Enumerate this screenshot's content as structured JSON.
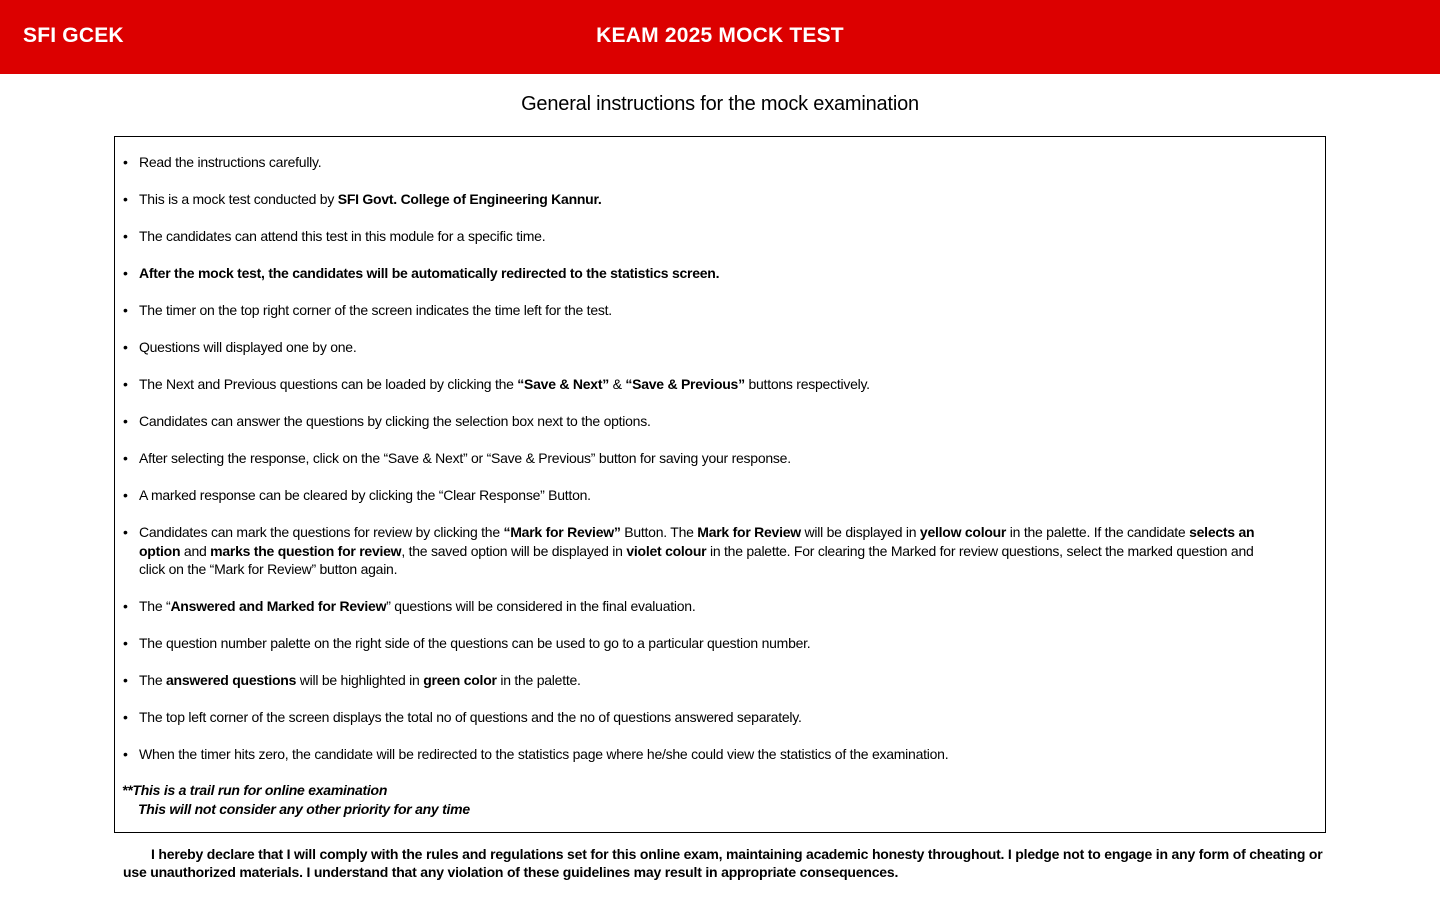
{
  "header": {
    "brand": "SFI GCEK",
    "title": "KEAM 2025 MOCK TEST",
    "bg_color": "#dc0000"
  },
  "heading": "General instructions for the mock examination",
  "instructions": [
    [
      {
        "t": "Read the instructions carefully."
      }
    ],
    [
      {
        "t": "This is a mock test conducted by "
      },
      {
        "t": "SFI Govt. College of Engineering Kannur.",
        "b": true
      }
    ],
    [
      {
        "t": "The candidates can attend this test in this module for a specific time."
      }
    ],
    [
      {
        "t": "After the mock test, the candidates will be automatically redirected to the statistics screen.",
        "b": true
      }
    ],
    [
      {
        "t": "The timer on the top right corner of the screen indicates the time left for the test."
      }
    ],
    [
      {
        "t": "Questions will displayed one by one."
      }
    ],
    [
      {
        "t": "The Next and Previous questions can be loaded by clicking the "
      },
      {
        "t": "“Save & Next”",
        "b": true
      },
      {
        "t": " & "
      },
      {
        "t": "“Save & Previous”",
        "b": true
      },
      {
        "t": " buttons respectively."
      }
    ],
    [
      {
        "t": "Candidates can answer the questions by clicking the selection box next to the options."
      }
    ],
    [
      {
        "t": "After selecting the response, click on the “Save & Next” or “Save & Previous” button for saving your response."
      }
    ],
    [
      {
        "t": "A marked response can be cleared by clicking the “Clear Response” Button."
      }
    ],
    [
      {
        "t": "Candidates can mark the questions for review by clicking the "
      },
      {
        "t": "“Mark for Review”",
        "b": true
      },
      {
        "t": " Button. The "
      },
      {
        "t": "Mark for Review",
        "b": true
      },
      {
        "t": " will be displayed in "
      },
      {
        "t": "yellow colour",
        "b": true
      },
      {
        "t": " in the palette. If the candidate "
      },
      {
        "t": "selects an option",
        "b": true
      },
      {
        "t": " and "
      },
      {
        "t": "marks the question for review",
        "b": true
      },
      {
        "t": ", the saved option will be displayed in "
      },
      {
        "t": "violet colour",
        "b": true
      },
      {
        "t": " in the palette. For clearing the Marked for review questions, select the marked question and click on the “Mark for Review” button again."
      }
    ],
    [
      {
        "t": "The “"
      },
      {
        "t": "Answered and Marked for Review",
        "b": true
      },
      {
        "t": "” questions will be considered in the final evaluation."
      }
    ],
    [
      {
        "t": "The question number palette on the right side of the questions can be used to go to a particular question number."
      }
    ],
    [
      {
        "t": "The "
      },
      {
        "t": "answered questions",
        "b": true
      },
      {
        "t": " will be highlighted in "
      },
      {
        "t": "green color",
        "b": true
      },
      {
        "t": " in the palette."
      }
    ],
    [
      {
        "t": "The top left corner of the screen displays the total no of questions and the no of questions answered separately."
      }
    ],
    [
      {
        "t": "When the timer hits zero, the candidate will be redirected to the statistics page where he/she could view the statistics of the examination."
      }
    ]
  ],
  "note": {
    "line1": "**This is a trail run for online examination",
    "line2": "This will not consider any other priority for any time"
  },
  "declaration": "I hereby declare that I will comply with the rules and regulations set for this online exam, maintaining academic honesty throughout. I pledge not to engage in any form of cheating or use unauthorized materials. I understand that any violation of these guidelines may result in appropriate consequences."
}
